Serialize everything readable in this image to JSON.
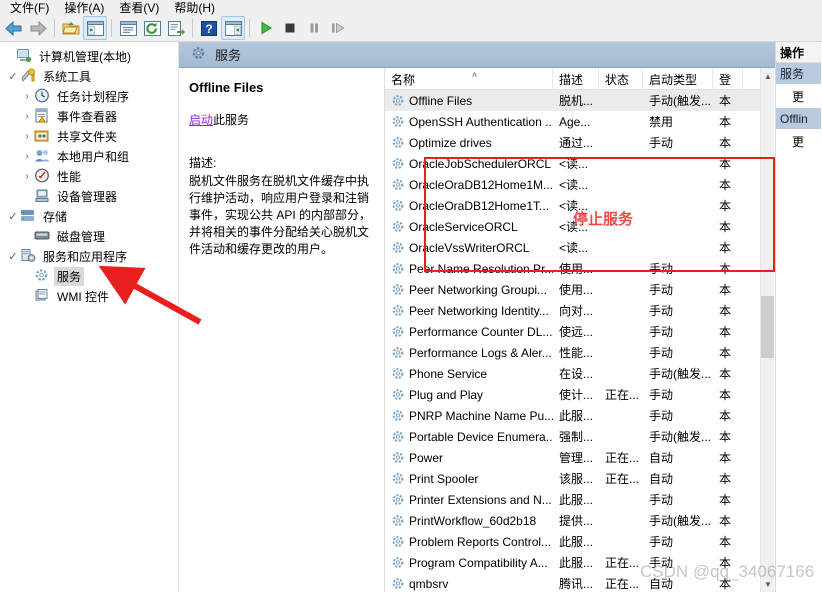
{
  "window": {
    "menu": [
      {
        "label": "文件(F)"
      },
      {
        "label": "操作(A)"
      },
      {
        "label": "查看(V)"
      },
      {
        "label": "帮助(H)"
      }
    ],
    "toolbar": [
      {
        "name": "back-arrow-icon",
        "glyph": "⬅"
      },
      {
        "name": "forward-arrow-icon",
        "glyph": "➡"
      },
      {
        "name": "up-folder-icon",
        "glyph": "📁"
      },
      {
        "name": "show-hide-tree-icon",
        "glyph": "▤"
      },
      {
        "name": "properties-icon",
        "glyph": "▥"
      },
      {
        "name": "refresh-icon",
        "glyph": "⟳"
      },
      {
        "name": "export-list-icon",
        "glyph": "⎙"
      },
      {
        "name": "help-icon",
        "glyph": "?"
      },
      {
        "name": "show-action-pane-icon",
        "glyph": "▦"
      },
      {
        "name": "start-service-icon",
        "glyph": "▶"
      },
      {
        "name": "stop-service-icon",
        "glyph": "■"
      },
      {
        "name": "pause-service-icon",
        "glyph": "❙❙"
      },
      {
        "name": "restart-service-icon",
        "glyph": "❙▶"
      }
    ]
  },
  "tree": {
    "items": [
      {
        "label": "计算机管理(本地)",
        "depth": 0,
        "twist": "",
        "icon": "computer-icon",
        "selected": false
      },
      {
        "label": "系统工具",
        "depth": 1,
        "twist": "✓",
        "icon": "tools-icon",
        "selected": false
      },
      {
        "label": "任务计划程序",
        "depth": 2,
        "twist": "›",
        "icon": "clock-icon",
        "selected": false
      },
      {
        "label": "事件查看器",
        "depth": 2,
        "twist": "›",
        "icon": "event-log-icon",
        "selected": false
      },
      {
        "label": "共享文件夹",
        "depth": 2,
        "twist": "›",
        "icon": "shared-folder-icon",
        "selected": false
      },
      {
        "label": "本地用户和组",
        "depth": 2,
        "twist": "›",
        "icon": "users-icon",
        "selected": false
      },
      {
        "label": "性能",
        "depth": 2,
        "twist": "›",
        "icon": "performance-icon",
        "selected": false
      },
      {
        "label": "设备管理器",
        "depth": 2,
        "twist": "",
        "icon": "device-manager-icon",
        "selected": false
      },
      {
        "label": "存储",
        "depth": 1,
        "twist": "✓",
        "icon": "storage-icon",
        "selected": false
      },
      {
        "label": "磁盘管理",
        "depth": 2,
        "twist": "",
        "icon": "disk-icon",
        "selected": false
      },
      {
        "label": "服务和应用程序",
        "depth": 1,
        "twist": "✓",
        "icon": "services-apps-icon",
        "selected": false
      },
      {
        "label": "服务",
        "depth": 2,
        "twist": "",
        "icon": "gear-icon",
        "selected": true
      },
      {
        "label": "WMI 控件",
        "depth": 2,
        "twist": "",
        "icon": "wmi-icon",
        "selected": false
      }
    ]
  },
  "center": {
    "header_title": "服务",
    "detail": {
      "service_title": "Offline Files",
      "action_link": "启动",
      "action_suffix": "此服务",
      "description_label": "描述:",
      "description_text": "脱机文件服务在脱机文件缓存中执行维护活动，响应用户登录和注销事件，实现公共 API 的内部部分，并将相关的事件分配给关心脱机文件活动和缓存更改的用户。"
    },
    "list": {
      "columns": [
        {
          "key": "name",
          "label": "名称",
          "sort": "˄"
        },
        {
          "key": "desc",
          "label": "描述",
          "sort": ""
        },
        {
          "key": "state",
          "label": "状态",
          "sort": ""
        },
        {
          "key": "start",
          "label": "启动类型",
          "sort": ""
        },
        {
          "key": "logon",
          "label": "登",
          "sort": ""
        }
      ],
      "rows": [
        {
          "name": "Offline Files",
          "desc": "脱机...",
          "state": "",
          "start": "手动(触发...",
          "logon": "本",
          "selected": true
        },
        {
          "name": "OpenSSH Authentication ...",
          "desc": "Age...",
          "state": "",
          "start": "禁用",
          "logon": "本",
          "selected": false
        },
        {
          "name": "Optimize drives",
          "desc": "通过...",
          "state": "",
          "start": "手动",
          "logon": "本",
          "selected": false
        },
        {
          "name": "OracleJobSchedulerORCL",
          "desc": "<读...",
          "state": "",
          "start": "",
          "logon": "本",
          "selected": false
        },
        {
          "name": "OracleOraDB12Home1M...",
          "desc": "<读...",
          "state": "",
          "start": "",
          "logon": "本",
          "selected": false
        },
        {
          "name": "OracleOraDB12Home1T...",
          "desc": "<读...",
          "state": "",
          "start": "",
          "logon": "本",
          "selected": false
        },
        {
          "name": "OracleServiceORCL",
          "desc": "<读...",
          "state": "",
          "start": "",
          "logon": "本",
          "selected": false
        },
        {
          "name": "OracleVssWriterORCL",
          "desc": "<读...",
          "state": "",
          "start": "",
          "logon": "本",
          "selected": false
        },
        {
          "name": "Peer Name Resolution Pr...",
          "desc": "使用...",
          "state": "",
          "start": "手动",
          "logon": "本",
          "selected": false
        },
        {
          "name": "Peer Networking Groupi...",
          "desc": "使用...",
          "state": "",
          "start": "手动",
          "logon": "本",
          "selected": false
        },
        {
          "name": "Peer Networking Identity...",
          "desc": "向对...",
          "state": "",
          "start": "手动",
          "logon": "本",
          "selected": false
        },
        {
          "name": "Performance Counter DL...",
          "desc": "使远...",
          "state": "",
          "start": "手动",
          "logon": "本",
          "selected": false
        },
        {
          "name": "Performance Logs & Aler...",
          "desc": "性能...",
          "state": "",
          "start": "手动",
          "logon": "本",
          "selected": false
        },
        {
          "name": "Phone Service",
          "desc": "在设...",
          "state": "",
          "start": "手动(触发...",
          "logon": "本",
          "selected": false
        },
        {
          "name": "Plug and Play",
          "desc": "使计...",
          "state": "正在...",
          "start": "手动",
          "logon": "本",
          "selected": false
        },
        {
          "name": "PNRP Machine Name Pu...",
          "desc": "此服...",
          "state": "",
          "start": "手动",
          "logon": "本",
          "selected": false
        },
        {
          "name": "Portable Device Enumera...",
          "desc": "强制...",
          "state": "",
          "start": "手动(触发...",
          "logon": "本",
          "selected": false
        },
        {
          "name": "Power",
          "desc": "管理...",
          "state": "正在...",
          "start": "自动",
          "logon": "本",
          "selected": false
        },
        {
          "name": "Print Spooler",
          "desc": "该服...",
          "state": "正在...",
          "start": "自动",
          "logon": "本",
          "selected": false
        },
        {
          "name": "Printer Extensions and N...",
          "desc": "此服...",
          "state": "",
          "start": "手动",
          "logon": "本",
          "selected": false
        },
        {
          "name": "PrintWorkflow_60d2b18",
          "desc": "提供...",
          "state": "",
          "start": "手动(触发...",
          "logon": "本",
          "selected": false
        },
        {
          "name": "Problem Reports Control...",
          "desc": "此服...",
          "state": "",
          "start": "手动",
          "logon": "本",
          "selected": false
        },
        {
          "name": "Program Compatibility A...",
          "desc": "此服...",
          "state": "正在...",
          "start": "手动",
          "logon": "本",
          "selected": false
        },
        {
          "name": "qmbsrv",
          "desc": "腾讯...",
          "state": "正在...",
          "start": "自动",
          "logon": "本",
          "selected": false
        }
      ]
    }
  },
  "actions": {
    "header": "操作",
    "groups": [
      {
        "title": "服务",
        "items": [
          "更"
        ]
      },
      {
        "title": "Offlin",
        "items": [
          "更"
        ]
      }
    ]
  },
  "annotations": {
    "stop_service_text": "停止服务",
    "watermark": "CSDN @qq_34067166",
    "box_color": "#e8201d",
    "text_color": "#f04a48",
    "arrow_color": "#e8201d"
  }
}
